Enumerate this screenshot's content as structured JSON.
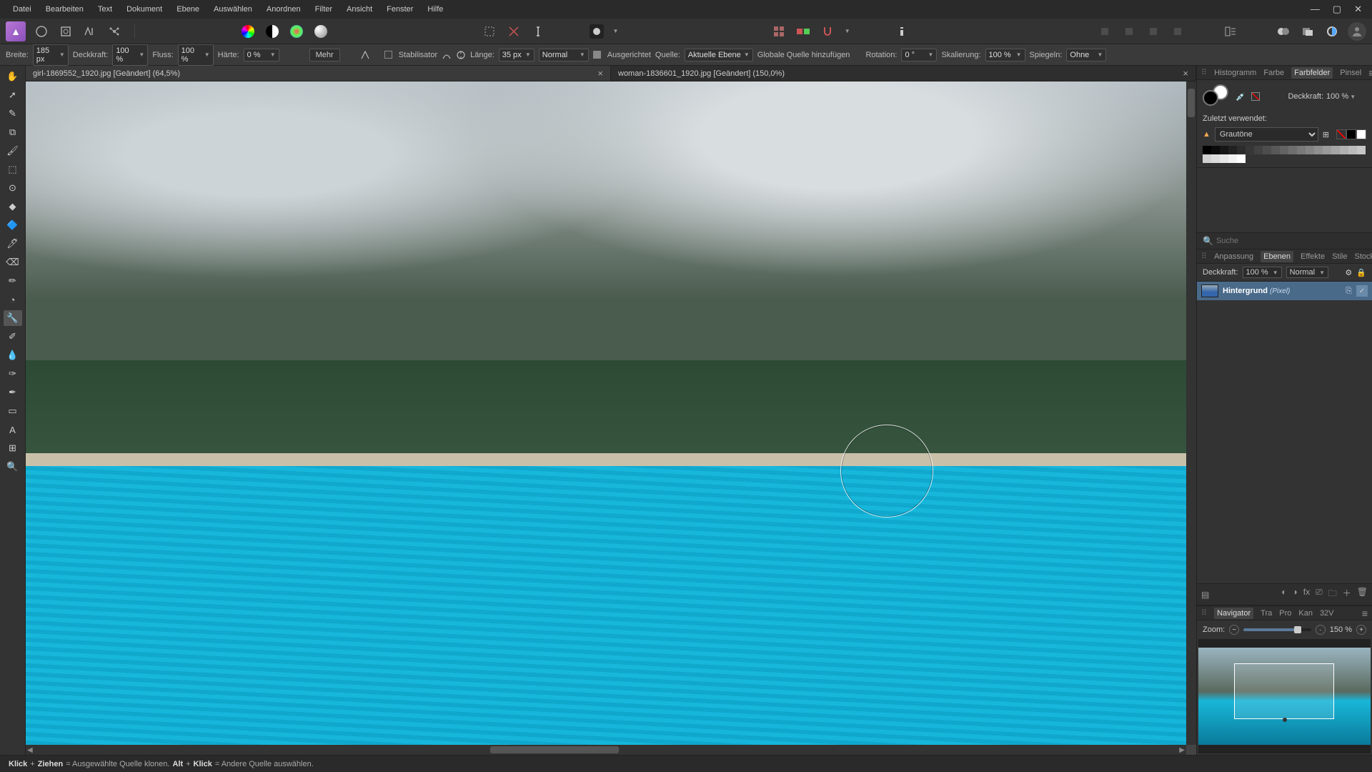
{
  "menu": [
    "Datei",
    "Bearbeiten",
    "Text",
    "Dokument",
    "Ebene",
    "Auswählen",
    "Anordnen",
    "Filter",
    "Ansicht",
    "Fenster",
    "Hilfe"
  ],
  "context": {
    "breite_lbl": "Breite:",
    "breite_val": "185 px",
    "deckkraft_lbl": "Deckkraft:",
    "deckkraft_val": "100 %",
    "fluss_lbl": "Fluss:",
    "fluss_val": "100 %",
    "haerte_lbl": "Härte:",
    "haerte_val": "0 %",
    "mehr": "Mehr",
    "stab": "Stabilisator",
    "laenge_lbl": "Länge:",
    "laenge_val": "35 px",
    "mode": "Normal",
    "ausger": "Ausgerichtet",
    "quelle_lbl": "Quelle:",
    "quelle_val": "Aktuelle Ebene",
    "add_src": "Globale Quelle hinzufügen",
    "rot_lbl": "Rotation:",
    "rot_val": "0 °",
    "skal_lbl": "Skalierung:",
    "skal_val": "100 %",
    "spiegel_lbl": "Spiegeln:",
    "spiegel_val": "Ohne"
  },
  "tabs": {
    "tab1": "girl-1869552_1920.jpg [Geändert] (64,5%)",
    "tab2": "woman-1836601_1920.jpg [Geändert] (150,0%)"
  },
  "right": {
    "tabs1": [
      "Histogramm",
      "Farbe",
      "Farbfelder",
      "Pinsel"
    ],
    "opacity_lbl": "Deckkraft:",
    "opacity_val": "100 %",
    "recent_lbl": "Zuletzt verwendet:",
    "grautone": "Grautöne",
    "search_ph": "Suche",
    "tabs2": [
      "Anpassung",
      "Ebenen",
      "Effekte",
      "Stile",
      "Stock"
    ],
    "lay_deck_lbl": "Deckkraft:",
    "lay_deck_val": "100 %",
    "lay_mode": "Normal",
    "layer_name": "Hintergrund",
    "layer_type": "(Pixel)",
    "tabs3": [
      "Navigator",
      "Tra",
      "Pro",
      "Kan",
      "32V"
    ],
    "zoom_lbl": "Zoom:",
    "zoom_val": "150 %"
  },
  "status": {
    "s1": "Klick",
    "s2": "+",
    "s3": "Ziehen",
    "s4": " = Ausgewählte Quelle klonen. ",
    "s5": "Alt",
    "s6": "+",
    "s7": "Klick",
    "s8": " = Andere Quelle auswählen."
  }
}
